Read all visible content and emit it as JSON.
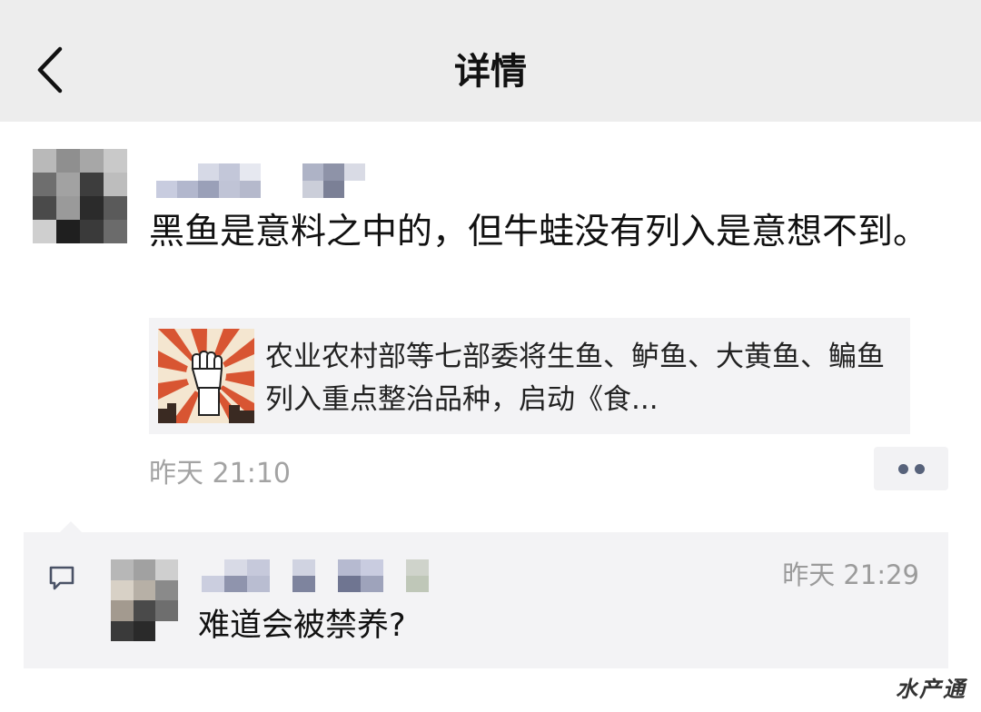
{
  "navbar": {
    "title": "详情"
  },
  "post": {
    "text": "黑鱼是意料之中的，但牛蛙没有列入是意想不到。",
    "link": {
      "title": "农业农村部等七部委将生鱼、鲈鱼、大黄鱼、鳊鱼列入重点整治品种，启动《食..."
    },
    "time": "昨天 21:10"
  },
  "comment": {
    "text": "难道会被禁养?",
    "time": "昨天 21:29"
  },
  "watermark": "水产通",
  "colors": {
    "navbar_bg": "#ededed",
    "card_bg": "#f3f3f5",
    "meta_text": "#a3a3a3",
    "dot": "#57627a"
  },
  "icons": {
    "back": "chevron-left-icon",
    "more": "more-dots-icon",
    "comment": "comment-bubble-icon"
  }
}
